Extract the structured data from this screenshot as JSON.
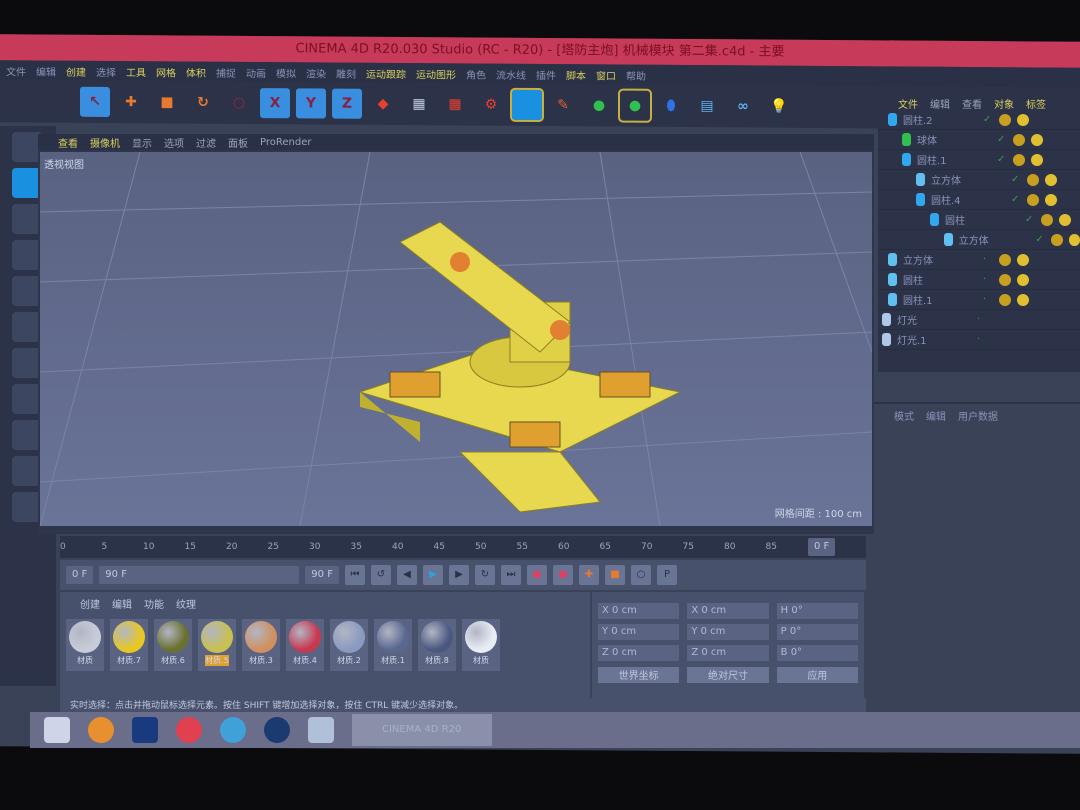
{
  "title": "CINEMA 4D R20.030 Studio (RC - R20) - [塔防主炮] 机械模块 第二集.c4d - 主要",
  "menu": [
    "文件",
    "编辑",
    "创建",
    "选择",
    "工具",
    "网格",
    "体积",
    "捕捉",
    "动画",
    "模拟",
    "渲染",
    "雕刻",
    "运动跟踪",
    "运动图形",
    "角色",
    "流水线",
    "插件",
    "脚本",
    "窗口",
    "帮助"
  ],
  "toolbar": {
    "x": "X",
    "y": "Y",
    "z": "Z"
  },
  "viewport": {
    "menu": [
      "查看",
      "摄像机",
      "显示",
      "选项",
      "过滤",
      "面板",
      "ProRender"
    ],
    "label": "透视视图",
    "grid": "网格间距 : 100 cm"
  },
  "objects": {
    "tabs": [
      "文件",
      "编辑",
      "查看",
      "对象",
      "标签"
    ],
    "items": [
      {
        "name": "圆柱.2",
        "type": "cylinder"
      },
      {
        "name": "球体",
        "type": "sphere"
      },
      {
        "name": "圆柱.1",
        "type": "cylinder"
      },
      {
        "name": "立方体",
        "type": "cube"
      },
      {
        "name": "圆柱.4",
        "type": "cylinder"
      },
      {
        "name": "圆柱",
        "type": "cylinder"
      },
      {
        "name": "立方体",
        "type": "cube"
      },
      {
        "name": "立方体",
        "type": "cube"
      },
      {
        "name": "圆柱",
        "type": "cube"
      },
      {
        "name": "圆柱.1",
        "type": "cube"
      },
      {
        "name": "灯光",
        "type": "light"
      },
      {
        "name": "灯光.1",
        "type": "light"
      }
    ]
  },
  "attributes": {
    "tabs": [
      "模式",
      "编辑",
      "用户数据"
    ]
  },
  "timeline": {
    "ticks": [
      "0",
      "5",
      "10",
      "15",
      "20",
      "25",
      "30",
      "35",
      "40",
      "45",
      "50",
      "55",
      "60",
      "65",
      "70",
      "75",
      "80",
      "85"
    ],
    "end": "0 F"
  },
  "anim": {
    "start": "0 F",
    "range": "90 F",
    "end": "90 F"
  },
  "materials": {
    "tabs": [
      "创建",
      "编辑",
      "功能",
      "纹理"
    ],
    "items": [
      {
        "name": "材质",
        "color": "#c8ccd8"
      },
      {
        "name": "材质.7",
        "color": "#e8c820"
      },
      {
        "name": "材质.6",
        "color": "#6a7030"
      },
      {
        "name": "材质.5",
        "color": "#c8c050"
      },
      {
        "name": "材质.3",
        "color": "#d09060"
      },
      {
        "name": "材质.4",
        "color": "#c83850"
      },
      {
        "name": "材质.2",
        "color": "#8a9ac0"
      },
      {
        "name": "材质.1",
        "color": "#5a6890"
      },
      {
        "name": "材质.8",
        "color": "#4a5880"
      },
      {
        "name": "材质",
        "color": "#e8ecf4"
      }
    ]
  },
  "coords": {
    "rows": [
      [
        "X 0 cm",
        "X 0 cm",
        "H 0°"
      ],
      [
        "Y 0 cm",
        "Y 0 cm",
        "P 0°"
      ],
      [
        "Z 0 cm",
        "Z 0 cm",
        "B 0°"
      ]
    ],
    "buttons": [
      "世界坐标",
      "绝对尺寸",
      "应用"
    ]
  },
  "status": "实时选择：点击并拖动鼠标选择元素。按住 SHIFT 键增加选择对象，按住 CTRL 键减少选择对象。",
  "taskbar": {
    "active": "CINEMA 4D R20"
  }
}
